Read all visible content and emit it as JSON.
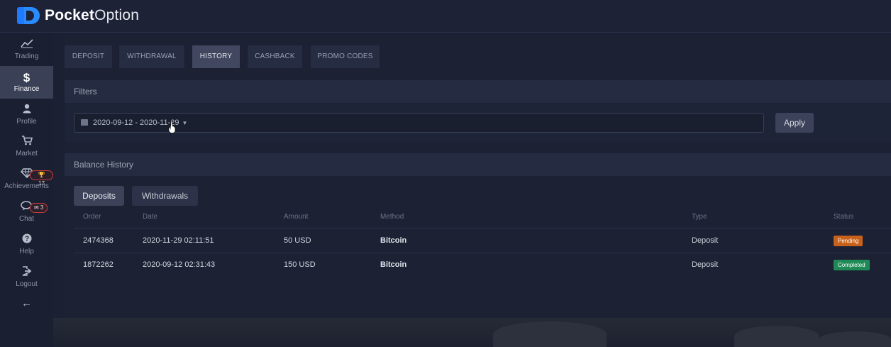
{
  "brand": {
    "bold": "Pocket",
    "light": "Option"
  },
  "sidebar": {
    "items": [
      {
        "label": "Trading",
        "icon": "chart-line-icon",
        "glyph": "⟋"
      },
      {
        "label": "Finance",
        "icon": "dollar-icon",
        "glyph": "$"
      },
      {
        "label": "Profile",
        "icon": "user-icon",
        "glyph": "●"
      },
      {
        "label": "Market",
        "icon": "cart-icon",
        "glyph": "🛒"
      },
      {
        "label": "Achievements",
        "icon": "diamond-icon",
        "glyph": "◇",
        "badge": "🏆 17"
      },
      {
        "label": "Chat",
        "icon": "chat-icon",
        "glyph": "💬",
        "badge": "✉ 3"
      },
      {
        "label": "Help",
        "icon": "help-icon",
        "glyph": "?"
      },
      {
        "label": "Logout",
        "icon": "logout-icon",
        "glyph": "⇥"
      }
    ],
    "collapse_glyph": "←"
  },
  "tabs": [
    "DEPOSIT",
    "WITHDRAWAL",
    "HISTORY",
    "CASHBACK",
    "PROMO CODES"
  ],
  "filters": {
    "title": "Filters",
    "date_range": "2020-09-12 - 2020-11-29",
    "apply_label": "Apply"
  },
  "balance_history": {
    "title": "Balance History",
    "subtabs": [
      "Deposits",
      "Withdrawals"
    ],
    "columns": [
      "Order",
      "Date",
      "Amount",
      "Method",
      "Type",
      "Status"
    ],
    "rows": [
      {
        "order": "2474368",
        "date": "2020-11-29 02:11:51",
        "amount": "50 USD",
        "method": "Bitcoin",
        "type": "Deposit",
        "status": "Pending"
      },
      {
        "order": "1872262",
        "date": "2020-09-12 02:31:43",
        "amount": "150 USD",
        "method": "Bitcoin",
        "type": "Deposit",
        "status": "Completed"
      }
    ]
  },
  "colors": {
    "accent": "#1e7bff",
    "pending": "#c8621a",
    "completed": "#1f8a55",
    "badge_border": "#c83b3b"
  }
}
